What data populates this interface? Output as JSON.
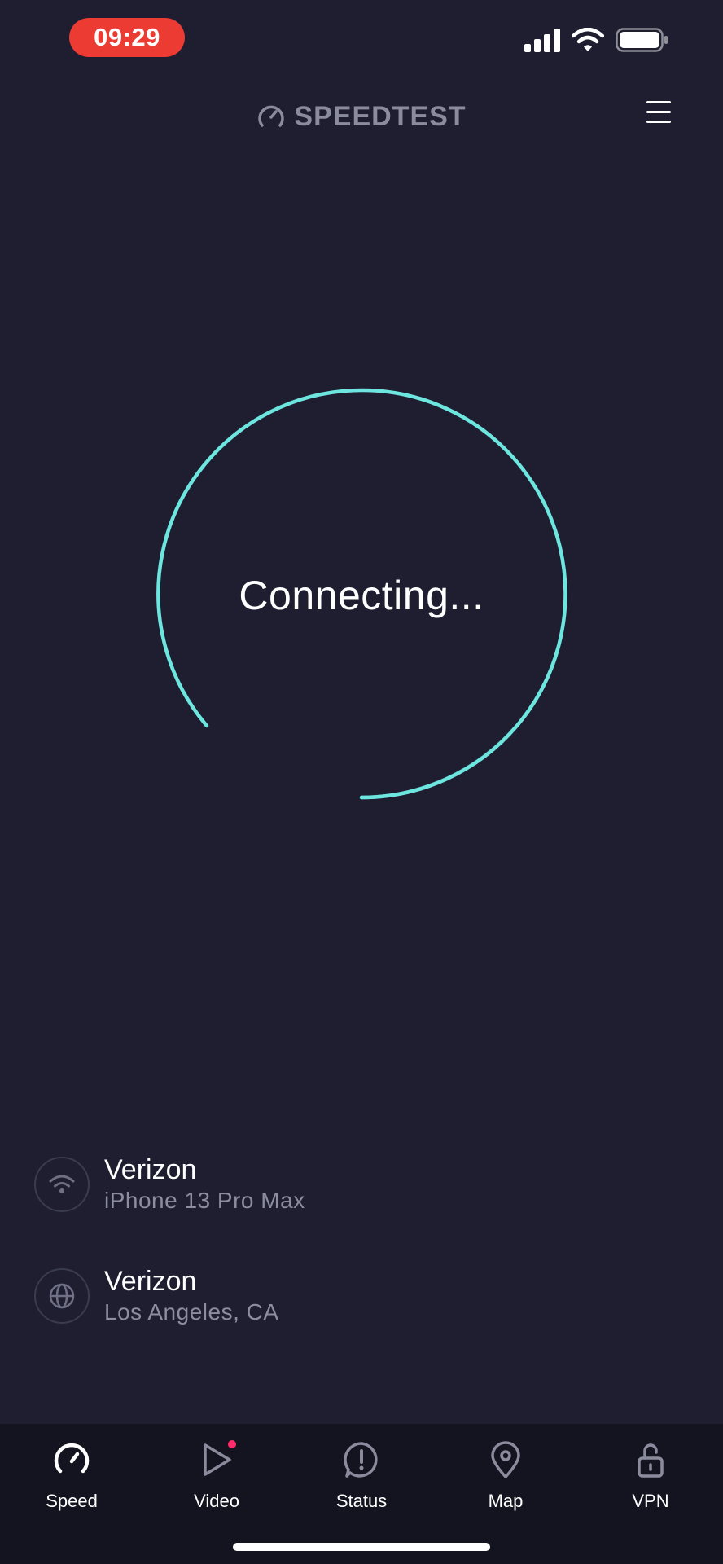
{
  "status_bar": {
    "time": "09:29"
  },
  "header": {
    "logo_text": "SPEEDTEST"
  },
  "gauge": {
    "label": "Connecting...",
    "accent_color": "#6ee6e0"
  },
  "connection": {
    "isp": {
      "name": "Verizon",
      "device": "iPhone 13 Pro Max",
      "icon": "wifi-icon"
    },
    "server": {
      "name": "Verizon",
      "location": "Los Angeles, CA",
      "icon": "globe-icon"
    }
  },
  "tabs": [
    {
      "label": "Speed",
      "icon": "speedometer-icon",
      "active": true
    },
    {
      "label": "Video",
      "icon": "play-icon",
      "badge": true
    },
    {
      "label": "Status",
      "icon": "alert-icon"
    },
    {
      "label": "Map",
      "icon": "location-pin-icon"
    },
    {
      "label": "VPN",
      "icon": "unlock-icon"
    }
  ]
}
